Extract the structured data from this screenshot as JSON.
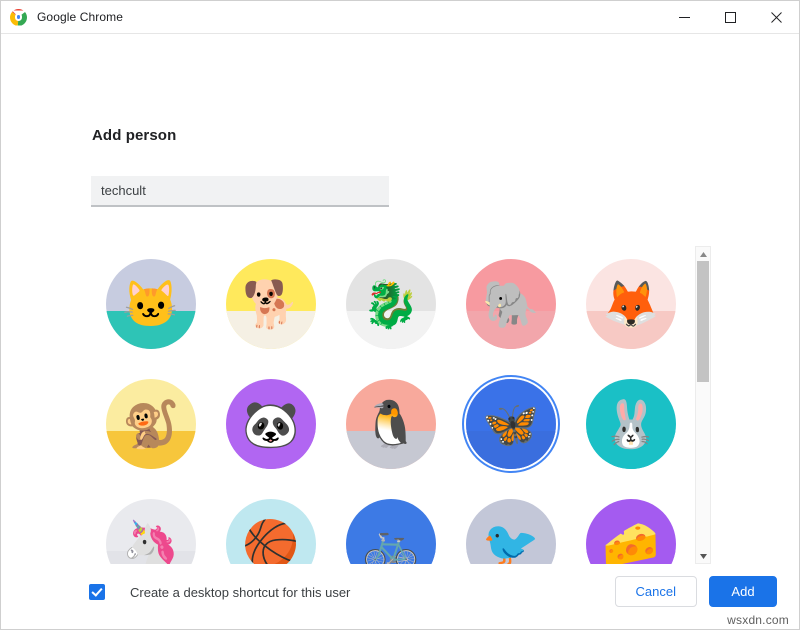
{
  "window": {
    "title": "Google Chrome",
    "logo_icon": "chrome-logo-icon",
    "controls": {
      "minimize": "minimize-icon",
      "maximize": "maximize-icon",
      "close": "close-icon"
    }
  },
  "dialog": {
    "heading": "Add person",
    "name_input": {
      "value": "techcult",
      "placeholder": ""
    },
    "checkbox": {
      "label": "Create a desktop shortcut for this user",
      "checked": true
    },
    "buttons": {
      "cancel": "Cancel",
      "add": "Add"
    }
  },
  "scrollbar": {
    "up_arrow_icon": "scroll-up-arrow-icon",
    "down_arrow_icon": "scroll-down-arrow-icon",
    "thumb_position_percent": 0,
    "thumb_size_percent": 42
  },
  "avatars": {
    "selected_index": 8,
    "items": [
      {
        "name": "cat",
        "icon": "origami-cat-icon",
        "bg": "#c7cce0",
        "bg2": "#2ec4b6",
        "glyph": "🐱"
      },
      {
        "name": "dog",
        "icon": "origami-dog-icon",
        "bg": "#ffe95c",
        "bg2": "#f5f0e4",
        "glyph": "🐕"
      },
      {
        "name": "dragon",
        "icon": "origami-dragon-icon",
        "bg": "#e3e3e3",
        "bg2": "#f2f2f2",
        "glyph": "🐉"
      },
      {
        "name": "elephant",
        "icon": "origami-elephant-icon",
        "bg": "#f79aa0",
        "bg2": "#f2a6ab",
        "glyph": "🐘"
      },
      {
        "name": "fox",
        "icon": "origami-fox-icon",
        "bg": "#fbe4e2",
        "bg2": "#f7c9c4",
        "glyph": "🦊"
      },
      {
        "name": "monkey",
        "icon": "origami-monkey-icon",
        "bg": "#fbeca0",
        "bg2": "#f7c63c",
        "glyph": "🐒"
      },
      {
        "name": "panda",
        "icon": "origami-panda-icon",
        "bg": "#b166f2",
        "bg2": "#b166f2",
        "glyph": "🐼"
      },
      {
        "name": "penguin",
        "icon": "origami-penguin-icon",
        "bg": "#f8a99c",
        "bg2": "#c6c8d2",
        "glyph": "🐧"
      },
      {
        "name": "butterfly",
        "icon": "origami-butterfly-icon",
        "bg": "#3a72e8",
        "bg2": "#3a6ede",
        "glyph": "🦋"
      },
      {
        "name": "rabbit",
        "icon": "origami-rabbit-icon",
        "bg": "#1ac0c6",
        "bg2": "#1ac0c6",
        "glyph": "🐰"
      },
      {
        "name": "unicorn",
        "icon": "unicorn-rainbow-icon",
        "bg": "#e9eaee",
        "bg2": "#e2e3e8",
        "glyph": "🦄"
      },
      {
        "name": "basketball",
        "icon": "basketball-icon",
        "bg": "#bfe8f0",
        "bg2": "#bfe8f0",
        "glyph": "🏀"
      },
      {
        "name": "bicycle",
        "icon": "bicycle-icon",
        "bg": "#3d7ae5",
        "bg2": "#3d7ae5",
        "glyph": "🚲"
      },
      {
        "name": "bird",
        "icon": "red-bird-icon",
        "bg": "#c3c7d8",
        "bg2": "#c3c7d8",
        "glyph": "🐦"
      },
      {
        "name": "cheese",
        "icon": "cheese-icon",
        "bg": "#a45bf0",
        "bg2": "#a45bf0",
        "glyph": "🧀"
      }
    ]
  },
  "watermark": "wsxdn.com"
}
